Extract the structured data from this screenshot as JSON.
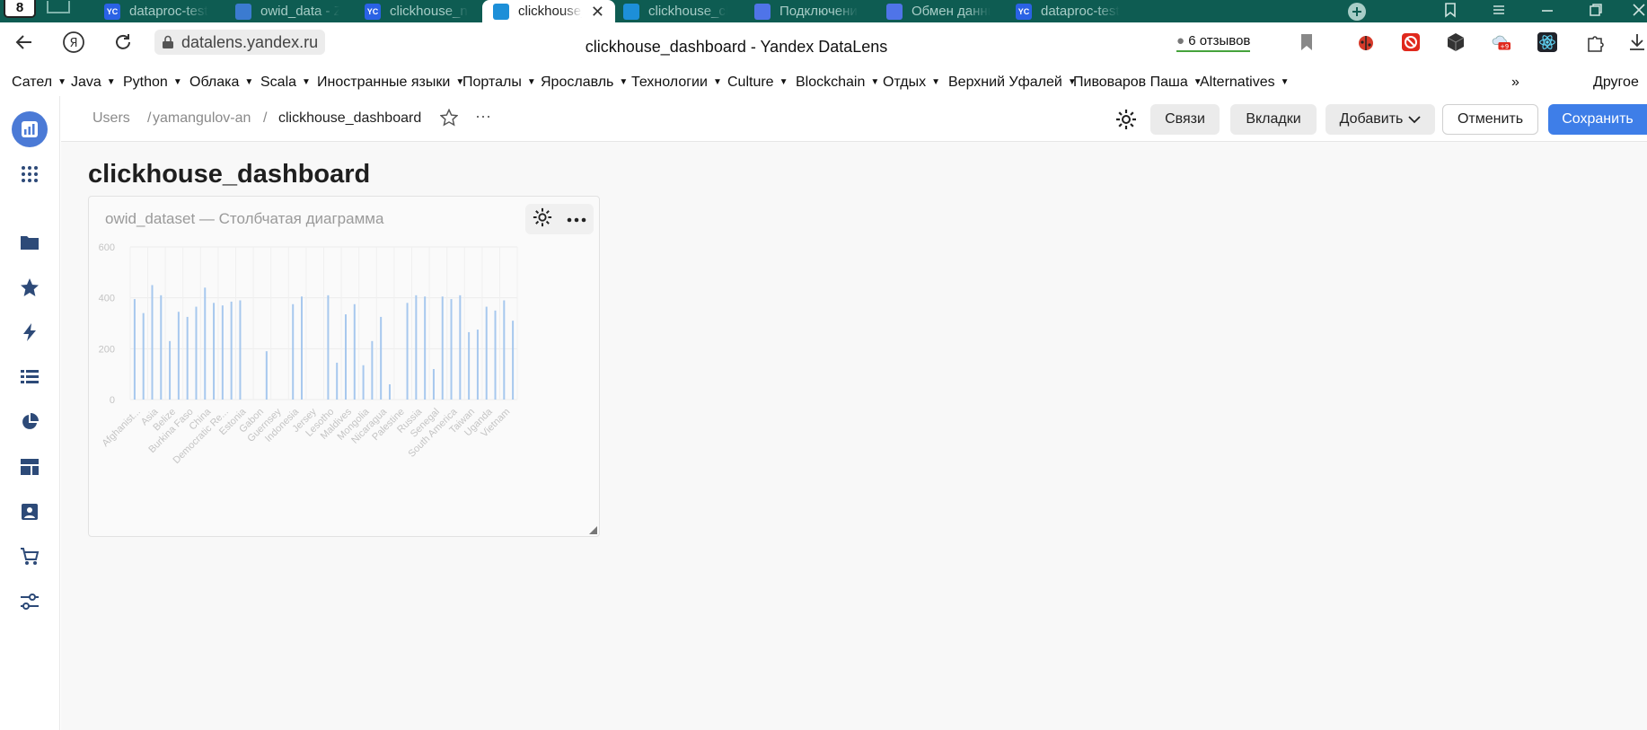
{
  "browser": {
    "tab_counter": "8",
    "tabs": [
      {
        "title": "dataproc-test-n",
        "favicon": "YC",
        "kind": "yc",
        "active": false
      },
      {
        "title": "owid_data - Zep",
        "favicon": "",
        "kind": "zep",
        "active": false
      },
      {
        "title": "clickhouse_net",
        "favicon": "YC",
        "kind": "yc",
        "active": false
      },
      {
        "title": "clickhouse_d",
        "favicon": "",
        "kind": "dl",
        "active": true
      },
      {
        "title": "clickhouse_clus",
        "favicon": "",
        "kind": "dl",
        "active": false
      },
      {
        "title": "Подключение",
        "favicon": "",
        "kind": "safari",
        "active": false
      },
      {
        "title": "Обмен данным",
        "favicon": "",
        "kind": "safari",
        "active": false
      },
      {
        "title": "dataproc-test-n",
        "favicon": "YC",
        "kind": "yc",
        "active": false
      }
    ],
    "url": "datalens.yandex.ru",
    "page_title": "clickhouse_dashboard - Yandex DataLens",
    "reviews": "6 отзывов",
    "badge": "+9",
    "bookmarks": [
      "Сател",
      "Java",
      "Python",
      "Облака",
      "Scala",
      "Иностранные языки",
      "Порталы",
      "Ярославль",
      "Технологии",
      "Culture",
      "Blockchain",
      "Отдых",
      "Верхний Уфалей",
      "Пивоваров Паша",
      "Alternatives"
    ],
    "bookmarks_more": "»",
    "bookmarks_other": "Другое"
  },
  "header": {
    "breadcrumbs": [
      "Users",
      "yamangulov-an",
      "clickhouse_dashboard"
    ],
    "separator": "/",
    "more": "···",
    "links_label": "Связи",
    "tabs_label": "Вкладки",
    "add_label": "Добавить",
    "cancel_label": "Отменить",
    "save_label": "Сохранить"
  },
  "dashboard": {
    "title": "clickhouse_dashboard",
    "widget_title": "owid_dataset — Столбчатая диаграмма"
  },
  "chart_data": {
    "type": "bar",
    "title": "owid_dataset — Столбчатая диаграмма",
    "ylim": [
      0,
      600
    ],
    "yticks": [
      0,
      200,
      400,
      600
    ],
    "color": "#a7c8ee",
    "grid": true,
    "xlabels": [
      "Afghanist...",
      "Asia",
      "Belize",
      "Burkina Faso",
      "China",
      "Democratic Re...",
      "Estonia",
      "Gabon",
      "Guernsey",
      "Indonesia",
      "Jersey",
      "Lesotho",
      "Maldives",
      "Mongolia",
      "Nicaragua",
      "Palestine",
      "Russia",
      "Senegal",
      "South America",
      "Taiwan",
      "Uganda",
      "Vietnam"
    ],
    "values": [
      395,
      340,
      450,
      410,
      230,
      345,
      325,
      365,
      440,
      380,
      370,
      385,
      390,
      0,
      0,
      190,
      0,
      0,
      375,
      405,
      0,
      0,
      410,
      145,
      335,
      375,
      135,
      230,
      325,
      60,
      0,
      380,
      410,
      405,
      120,
      405,
      395,
      410,
      265,
      275,
      365,
      350,
      390,
      310
    ]
  }
}
